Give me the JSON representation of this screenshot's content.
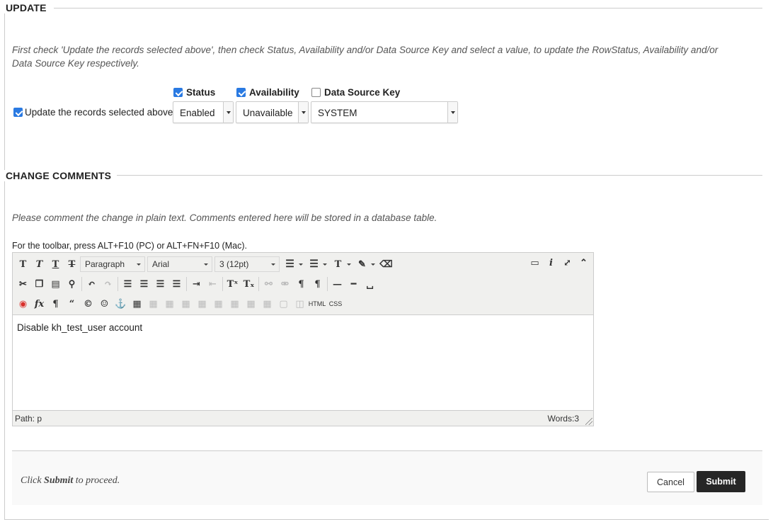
{
  "update": {
    "heading": "UPDATE",
    "instructions": "First check 'Update the records selected above', then check Status, Availability and/or Data Source Key and select a value, to update the RowStatus, Availability and/or Data Source Key respectively.",
    "update_checkbox_label": "Update the records selected above",
    "status_label": "Status",
    "availability_label": "Availability",
    "data_source_key_label": "Data Source Key",
    "status_value": "Enabled",
    "availability_value": "Unavailable",
    "data_source_key_value": "SYSTEM"
  },
  "comments": {
    "heading": "CHANGE COMMENTS",
    "instructions": "Please comment the change in plain text. Comments entered here will be stored in a database table.",
    "toolbar_hint": "For the toolbar, press ALT+F10 (PC) or ALT+FN+F10 (Mac).",
    "format_value": "Paragraph",
    "font_value": "Arial",
    "size_value": "3 (12pt)",
    "content": "Disable kh_test_user account",
    "path": "Path: p",
    "words": "Words:3",
    "html_btn": "HTML",
    "css_btn": "CSS"
  },
  "submit": {
    "note_prefix": "Click ",
    "note_bold": "Submit",
    "note_suffix": " to proceed.",
    "cancel_label": "Cancel",
    "submit_label": "Submit"
  },
  "colors": {
    "checkbox_blue": "#2a7ae2",
    "submit_button": "#262626"
  }
}
